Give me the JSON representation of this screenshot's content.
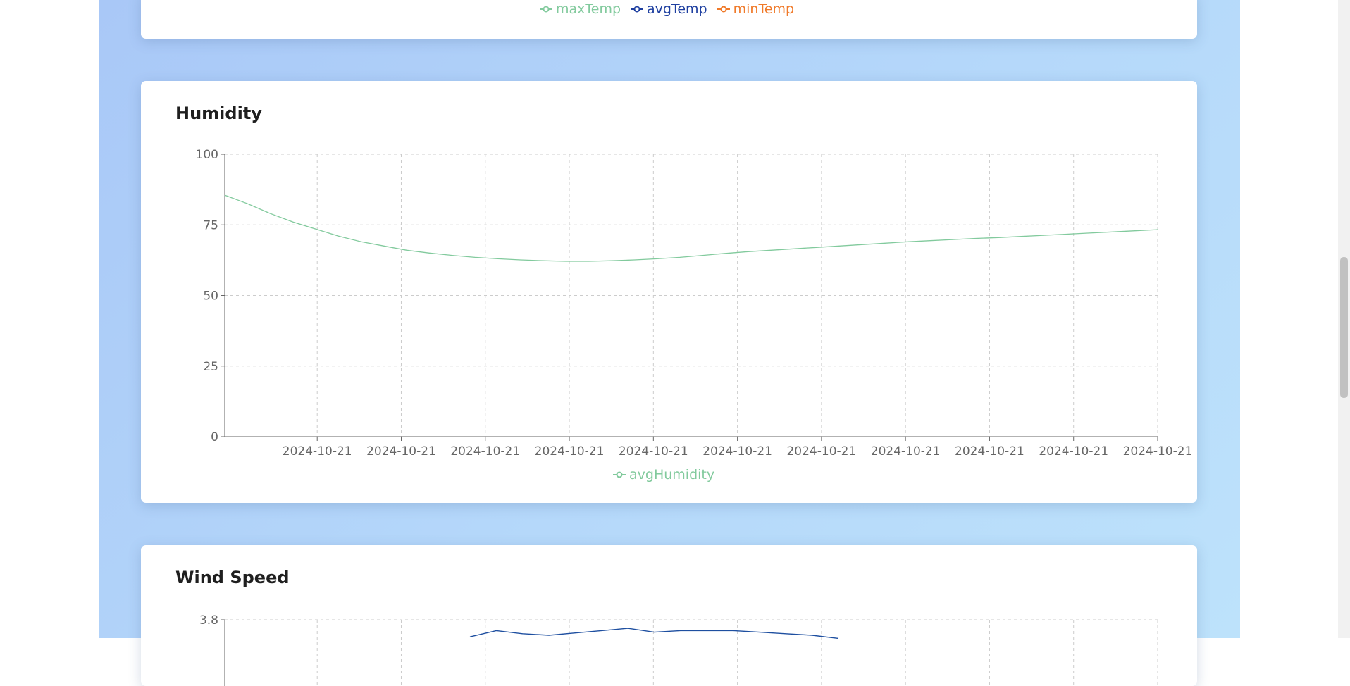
{
  "top_legend": {
    "items": [
      {
        "label": "maxTemp",
        "color": "#82ca9d"
      },
      {
        "label": "avgTemp",
        "color": "#1e3fa0"
      },
      {
        "label": "minTemp",
        "color": "#f07a2a"
      }
    ]
  },
  "humidity": {
    "title": "Humidity",
    "legend_label": "avgHumidity",
    "color": "#82ca9d"
  },
  "wind": {
    "title": "Wind Speed",
    "color": "#1e4fa0"
  },
  "chart_data": [
    {
      "type": "line",
      "title": "Humidity",
      "xlabel": "",
      "ylabel": "",
      "ylim": [
        0,
        100
      ],
      "yticks": [
        0,
        25,
        50,
        75,
        100
      ],
      "xticks": [
        "2024-10-21",
        "2024-10-21",
        "2024-10-21",
        "2024-10-21",
        "2024-10-21",
        "2024-10-21",
        "2024-10-21",
        "2024-10-21",
        "2024-10-21",
        "2024-10-21",
        "2024-10-21"
      ],
      "grid": true,
      "legend": "bottom",
      "series": [
        {
          "name": "avgHumidity",
          "color": "#82ca9d",
          "values": [
            85.5,
            82.5,
            79,
            76,
            73.5,
            71,
            69,
            67.5,
            66,
            65,
            64.2,
            63.5,
            63,
            62.6,
            62.3,
            62.1,
            62.1,
            62.3,
            62.6,
            63,
            63.5,
            64.2,
            64.9,
            65.5,
            66,
            66.5,
            67,
            67.5,
            68,
            68.5,
            69,
            69.4,
            69.8,
            70.2,
            70.5,
            70.9,
            71.3,
            71.7,
            72.1,
            72.5,
            72.9,
            73.3
          ]
        }
      ]
    },
    {
      "type": "line",
      "title": "Wind Speed",
      "xlabel": "",
      "ylabel": "",
      "yticks": [
        3.8
      ],
      "grid": true,
      "series": [
        {
          "color": "#1e4fa0",
          "values": [
            3.58,
            3.66,
            3.62,
            3.6,
            3.63,
            3.66,
            3.69,
            3.64,
            3.66,
            3.66,
            3.66,
            3.64,
            3.62,
            3.6,
            3.56
          ]
        }
      ]
    }
  ]
}
